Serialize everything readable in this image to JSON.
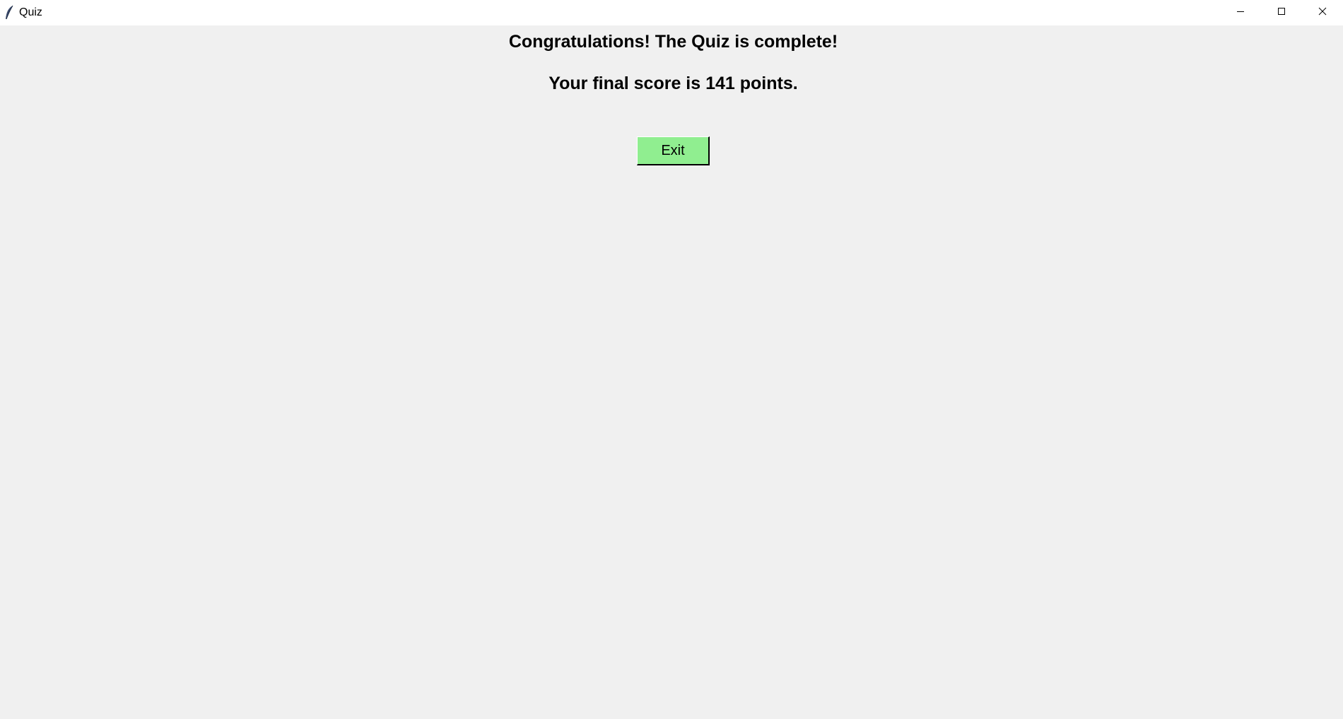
{
  "window": {
    "title": "Quiz",
    "icon": "feather-icon",
    "controls": {
      "minimize_icon": "minimize-icon",
      "maximize_icon": "maximize-icon",
      "close_icon": "close-icon"
    }
  },
  "main": {
    "congrats_text": "Congratulations! The Quiz is complete!",
    "score_text": "Your final score is 141 points.",
    "exit_label": "Exit"
  },
  "colors": {
    "background": "#f0f0f0",
    "titlebar": "#ffffff",
    "exit_button": "#90ee90"
  }
}
